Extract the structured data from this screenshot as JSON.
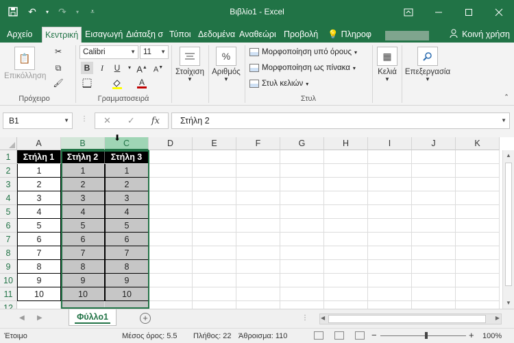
{
  "app": {
    "title": "Βιβλίο1 - Excel",
    "theme_color": "#217346"
  },
  "qat": {
    "icons": [
      "save-icon",
      "undo-icon",
      "redo-icon",
      "customize-icon"
    ]
  },
  "window_controls": {
    "icons": [
      "ribbon-display-icon",
      "minimize-icon",
      "maximize-icon",
      "close-icon"
    ]
  },
  "tabs": [
    {
      "label": "Αρχείο",
      "active": false
    },
    {
      "label": "Κεντρική",
      "active": true
    },
    {
      "label": "Εισαγωγή",
      "active": false
    },
    {
      "label": "Διάταξη σ",
      "active": false
    },
    {
      "label": "Τύποι",
      "active": false
    },
    {
      "label": "Δεδομένα",
      "active": false
    },
    {
      "label": "Αναθεώρι",
      "active": false
    },
    {
      "label": "Προβολή",
      "active": false
    }
  ],
  "tell_me": "Πληροφ",
  "share": "Κοινή χρήση",
  "ribbon": {
    "clipboard": {
      "paste": "Επικόλληση",
      "label": "Πρόχειρο"
    },
    "font": {
      "name": "Calibri",
      "size": "11",
      "label": "Γραμματοσειρά",
      "bold": "B",
      "italic": "I",
      "underline": "U"
    },
    "alignment": {
      "label": "Στοίχιση"
    },
    "number": {
      "label": "Αριθμός",
      "symbol": "%"
    },
    "styles": {
      "conditional": "Μορφοποίηση υπό όρους",
      "as_table": "Μορφοποίηση ως πίνακα",
      "cell_styles": "Στυλ κελιών",
      "label": "Στυλ"
    },
    "cells": {
      "label": "Κελιά"
    },
    "editing": {
      "label": "Επεξεργασία"
    }
  },
  "formula_bar": {
    "name_box": "B1",
    "cancel": "✕",
    "enter": "✓",
    "fx": "fx",
    "content": "Στήλη 2"
  },
  "grid": {
    "columns": [
      "A",
      "B",
      "C",
      "D",
      "E",
      "F",
      "G",
      "H",
      "I",
      "J",
      "K"
    ],
    "rows": [
      "1",
      "2",
      "3",
      "4",
      "5",
      "6",
      "7",
      "8",
      "9",
      "10",
      "11",
      "12"
    ],
    "headers": [
      "Στήλη 1",
      "Στήλη 2",
      "Στήλη 3"
    ],
    "values": [
      [
        "1",
        "1",
        "1"
      ],
      [
        "2",
        "2",
        "2"
      ],
      [
        "3",
        "3",
        "3"
      ],
      [
        "4",
        "4",
        "4"
      ],
      [
        "5",
        "5",
        "5"
      ],
      [
        "6",
        "6",
        "6"
      ],
      [
        "7",
        "7",
        "7"
      ],
      [
        "8",
        "8",
        "8"
      ],
      [
        "9",
        "9",
        "9"
      ],
      [
        "10",
        "10",
        "10"
      ]
    ]
  },
  "sheets": [
    {
      "name": "Φύλλο1",
      "active": true
    }
  ],
  "status": {
    "mode": "Έτοιμο",
    "average": "Μέσος όρος: 5.5",
    "count": "Πλήθος: 22",
    "sum": "Άθροισμα: 110",
    "zoom": "100%"
  }
}
